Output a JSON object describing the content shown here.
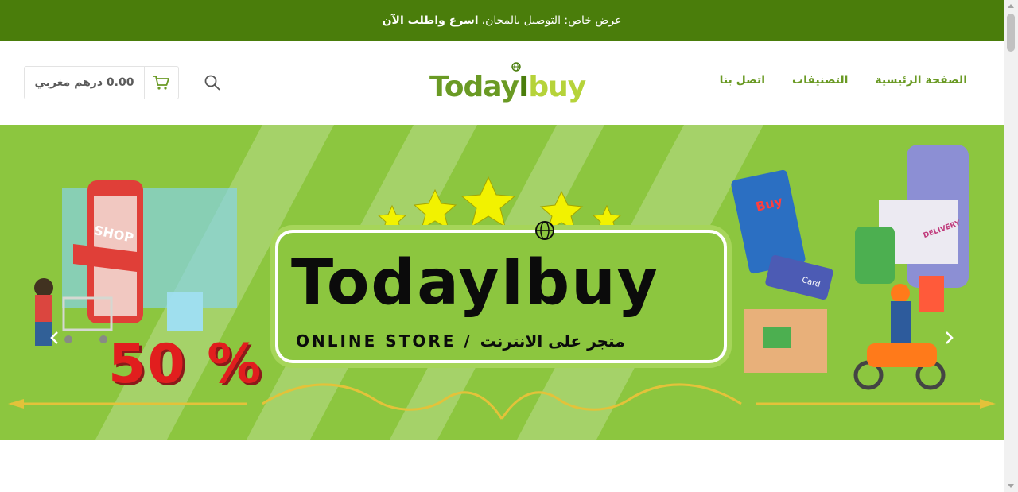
{
  "announcement": {
    "text": "عرض خاص: التوصيل بالمجان،",
    "emphasis": "اسرع واطلب الآن"
  },
  "header": {
    "cart_total": "0.00 درهم مغربي",
    "cart_icon": "cart-icon",
    "search_icon": "search-icon",
    "logo_parts": [
      "Today",
      "I",
      "buy"
    ],
    "nav": [
      "الصفحة الرئيسية",
      "التصنيفات",
      "اتصل بنا"
    ]
  },
  "hero": {
    "brand_title": "TodayIbuy",
    "brand_subtitle": "ONLINE STORE / متجر على الانترنت",
    "discount": "50 %",
    "shop_label": "SHOP",
    "buy_label": "Buy",
    "delivery_label": "DELIVERY",
    "card_label": "Card",
    "prev_icon": "chevron-left-icon",
    "next_icon": "chevron-right-icon"
  },
  "colors": {
    "announcement_bg": "#4a7d0b",
    "accent": "#6a9a24",
    "hero_bg": "#8cc63f",
    "discount": "#e11e1e",
    "star": "#f2f200"
  }
}
